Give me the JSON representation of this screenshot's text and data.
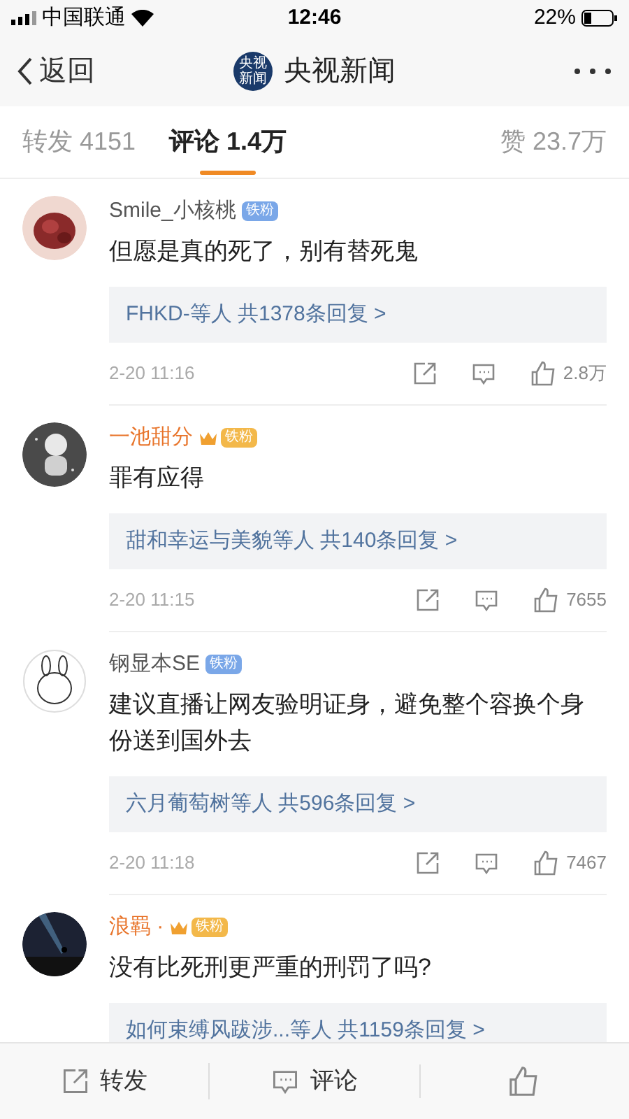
{
  "status_bar": {
    "carrier": "中国联通",
    "time": "12:46",
    "battery": "22%"
  },
  "nav": {
    "back": "返回",
    "title": "央视新闻",
    "logo_text": "央视新闻"
  },
  "tabs": [
    {
      "label": "转发",
      "count": "4151",
      "selected": false
    },
    {
      "label": "评论",
      "count": "1.4万",
      "selected": true
    }
  ],
  "likes_tab": {
    "label": "赞",
    "count": "23.7万"
  },
  "comments": [
    {
      "name": "Smile_小核桃",
      "vip": false,
      "badge": "铁粉",
      "text": "但愿是真的死了，别有替死鬼",
      "replies": "FHKD-等人  共1378条回复 >",
      "time": "2-20 11:16",
      "likes": "2.8万"
    },
    {
      "name": "一池甜分",
      "vip": true,
      "badge": "铁粉",
      "text": "罪有应得",
      "replies": "甜和幸运与美貌等人  共140条回复 >",
      "time": "2-20 11:15",
      "likes": "7655"
    },
    {
      "name": "钢显本SE",
      "vip": false,
      "badge": "铁粉",
      "text": "建议直播让网友验明证身，避免整个容换个身份送到国外去",
      "replies": "六月葡萄树等人  共596条回复 >",
      "time": "2-20 11:18",
      "likes": "7467"
    },
    {
      "name": "浪羁 ·",
      "vip": true,
      "badge": "铁粉",
      "text": "没有比死刑更严重的刑罚了吗?",
      "replies": "如何束缚风跋涉...等人  共1159条回复 >"
    }
  ],
  "bottom_bar": [
    {
      "kind": "repost",
      "label": "转发"
    },
    {
      "kind": "comment",
      "label": "评论"
    },
    {
      "kind": "like"
    }
  ]
}
